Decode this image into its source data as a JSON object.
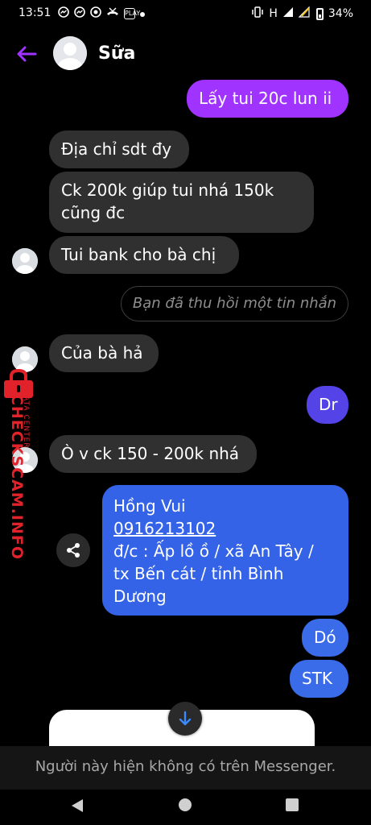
{
  "status_bar": {
    "time": "13:51",
    "left_icons": [
      "messenger-icon",
      "messenger-icon",
      "vpn-icon",
      "missed-call-icon",
      "play-store-icon",
      "dot-icon"
    ],
    "play_label": "PLAY",
    "network": "H",
    "battery": "34%"
  },
  "header": {
    "contact_name": "Sữa",
    "accent_color": "#a033ff"
  },
  "messages": {
    "m1": "Lấy tui 20c lun ii",
    "m2": "Địa chỉ sdt đy",
    "m3": "Ck 200k giúp tui nhá 150k\ncũng đc",
    "m4": "Tui bank cho bà chị",
    "unsent": "Bạn đã thu hồi một tin nhắn",
    "m5": "Của bà hả",
    "m6": "Dr",
    "m7": "Ò v ck 150 - 200k nhá",
    "card_name": "Hồng Vui",
    "card_phone": "0916213102",
    "card_address": "đ/c : Ấp lồ ồ / xã An Tây /\ntx Bến cát / tỉnh Bình\nDương",
    "m8": "Dó",
    "m9": "STK"
  },
  "watermark": {
    "main": "CHECKSCAM.INFO",
    "sub": "DATA CENTER"
  },
  "footer": {
    "notice": "Người này hiện không có trên Messenger."
  },
  "colors": {
    "outgoing_purple": "#a033ff",
    "outgoing_blue": "#3a6be8",
    "incoming": "#303030",
    "watermark_red": "#e2222a"
  }
}
